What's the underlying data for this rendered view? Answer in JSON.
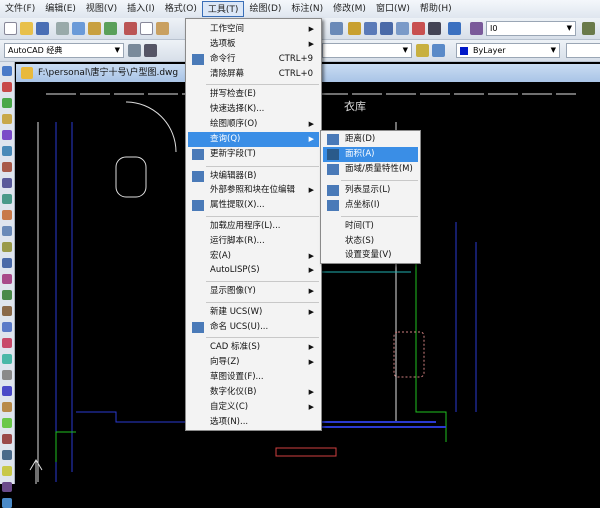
{
  "menubar": [
    "文件(F)",
    "编辑(E)",
    "视图(V)",
    "插入(I)",
    "格式(O)",
    "工具(T)",
    "绘图(D)",
    "标注(N)",
    "修改(M)",
    "窗口(W)",
    "帮助(H)"
  ],
  "toolbar": {
    "text_style": "I0",
    "workspace": "AutoCAD 经典",
    "color": "ByLayer"
  },
  "document": {
    "title": "F:\\personal\\唐宁十号\\户型图.dwg",
    "room_label": "衣库"
  },
  "tools_menu": [
    {
      "label": "工作空间",
      "sub": true
    },
    {
      "label": "选项板",
      "sub": true
    },
    {
      "label": "命令行",
      "shortcut": "CTRL+9",
      "icon": "command-line-icon"
    },
    {
      "label": "清除屏幕",
      "shortcut": "CTRL+0"
    },
    {
      "label": "拼写检查(E)"
    },
    {
      "label": "快速选择(K)..."
    },
    {
      "label": "绘图顺序(O)",
      "sub": true
    },
    {
      "label": "查询(Q)",
      "sub": true,
      "highlighted": true
    },
    {
      "label": "更新字段(T)",
      "icon": "update-fields-icon"
    },
    {
      "label": "块编辑器(B)",
      "icon": "block-editor-icon"
    },
    {
      "label": "外部参照和块在位编辑",
      "sub": true
    },
    {
      "label": "属性提取(X)...",
      "icon": "attribute-extract-icon"
    },
    {
      "label": "加载应用程序(L)..."
    },
    {
      "label": "运行脚本(R)..."
    },
    {
      "label": "宏(A)",
      "sub": true
    },
    {
      "label": "AutoLISP(S)",
      "sub": true
    },
    {
      "label": "显示图像(Y)",
      "sub": true
    },
    {
      "label": "新建 UCS(W)",
      "sub": true
    },
    {
      "label": "命名 UCS(U)...",
      "icon": "ucs-icon"
    },
    {
      "label": "CAD 标准(S)",
      "sub": true
    },
    {
      "label": "向导(Z)",
      "sub": true
    },
    {
      "label": "草图设置(F)..."
    },
    {
      "label": "数字化仪(B)",
      "sub": true
    },
    {
      "label": "自定义(C)",
      "sub": true
    },
    {
      "label": "选项(N)..."
    }
  ],
  "inquiry_submenu": [
    {
      "label": "距离(D)",
      "icon": "distance-icon"
    },
    {
      "label": "面积(A)",
      "icon": "area-icon",
      "highlighted": true
    },
    {
      "label": "面域/质量特性(M)",
      "icon": "mass-properties-icon"
    },
    {
      "label": "列表显示(L)",
      "icon": "list-icon"
    },
    {
      "label": "点坐标(I)",
      "icon": "point-coordinate-icon"
    },
    {
      "label": "时间(T)"
    },
    {
      "label": "状态(S)"
    },
    {
      "label": "设置变量(V)"
    }
  ]
}
